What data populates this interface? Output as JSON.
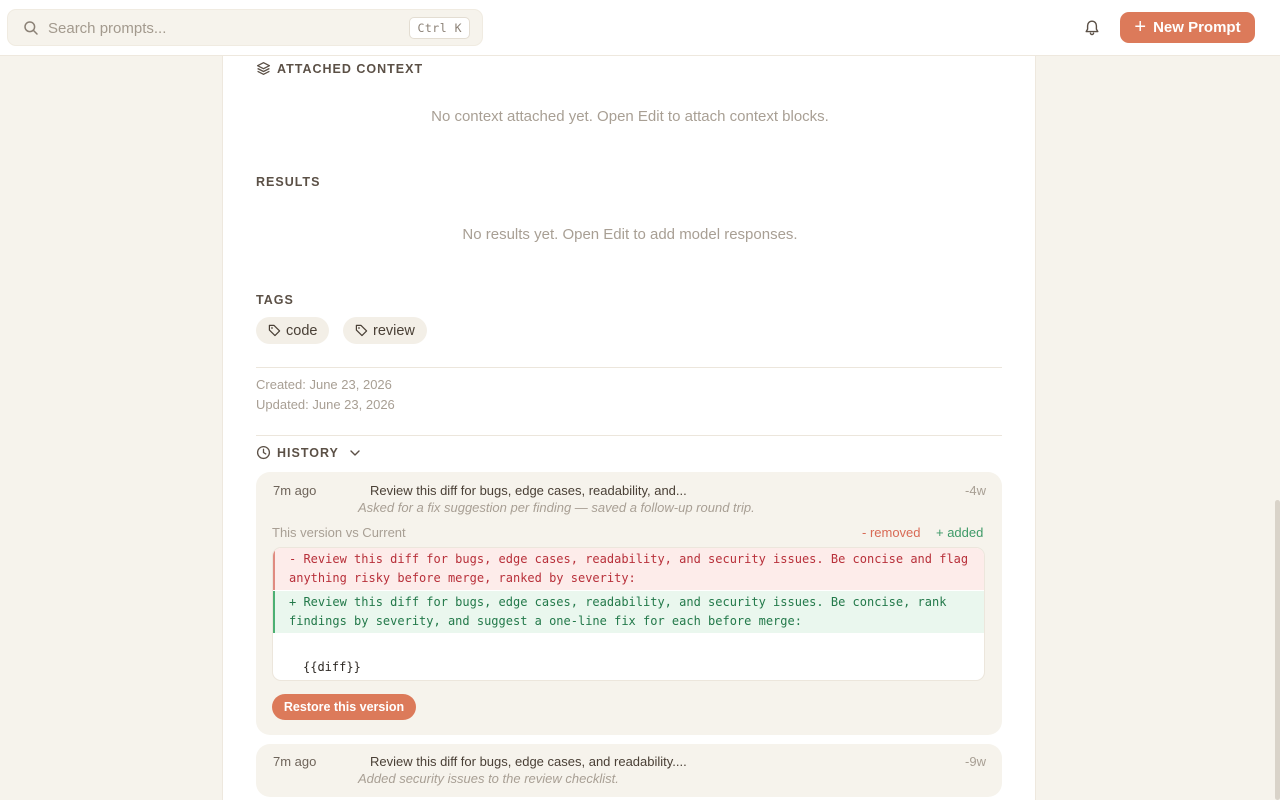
{
  "topbar": {
    "search_placeholder": "Search prompts...",
    "shortcut": "Ctrl K",
    "new_prompt_label": "New Prompt",
    "accent_color": "#dc7a5a"
  },
  "attached_context": {
    "label": "ATTACHED CONTEXT",
    "empty": "No context attached yet. Open Edit to attach context blocks."
  },
  "results": {
    "label": "RESULTS",
    "empty": "No results yet. Open Edit to add model responses."
  },
  "tags": {
    "label": "TAGS",
    "items": [
      "code",
      "review"
    ]
  },
  "meta": {
    "created": "Created: June 23, 2026",
    "updated": "Updated: June 23, 2026"
  },
  "history": {
    "label": "HISTORY",
    "entries": [
      {
        "time": "7m ago",
        "summary": "Review this diff for bugs, edge cases, readability, and...",
        "note": "Asked for a fix suggestion per finding — saved a follow-up round trip.",
        "delta": "-4w",
        "compare_label": "This version vs Current",
        "legend_removed": "- removed",
        "legend_added": "+ added",
        "removed_lines": "- Review this diff for bugs, edge cases, readability, and security issues. Be concise and flag\nanything risky before merge, ranked by severity:",
        "added_lines": "+ Review this diff for bugs, edge cases, readability, and security issues. Be concise, rank\nfindings by severity, and suggest a one-line fix for each before merge:",
        "context_line": "{{diff}}",
        "restore_label": "Restore this version"
      },
      {
        "time": "7m ago",
        "summary": "Review this diff for bugs, edge cases, and readability....",
        "note": "Added security issues to the review checklist.",
        "delta": "-9w"
      }
    ]
  }
}
